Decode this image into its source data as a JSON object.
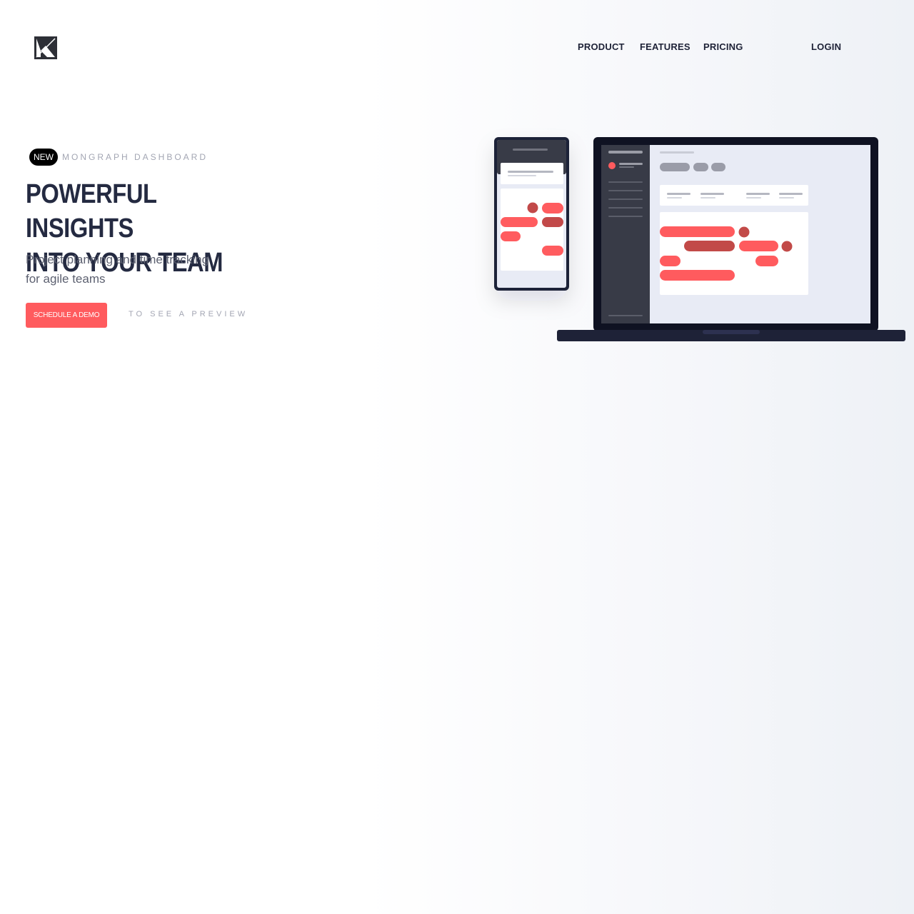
{
  "brand": {
    "logo_icon": "k-logo-icon"
  },
  "nav": {
    "product": "PRODUCT",
    "features": "FEATURES",
    "pricing": "PRICING",
    "login": "LOGIN"
  },
  "hero": {
    "badge": "NEW",
    "eyebrow": "MONGRAPH DASHBOARD",
    "headline_line1": "POWERFUL INSIGHTS",
    "headline_line2": "INTO YOUR TEAM",
    "subtitle_line1": "Project planning and time tracking",
    "subtitle_line2": "for agile teams",
    "cta_label": "SCHEDULE A DEMO",
    "preview_label": "TO SEE A PREVIEW"
  },
  "colors": {
    "accent": "#ff5b5e",
    "accent_dark": "#c24a48",
    "navy": "#1e2237",
    "sidebar": "#383b47"
  }
}
